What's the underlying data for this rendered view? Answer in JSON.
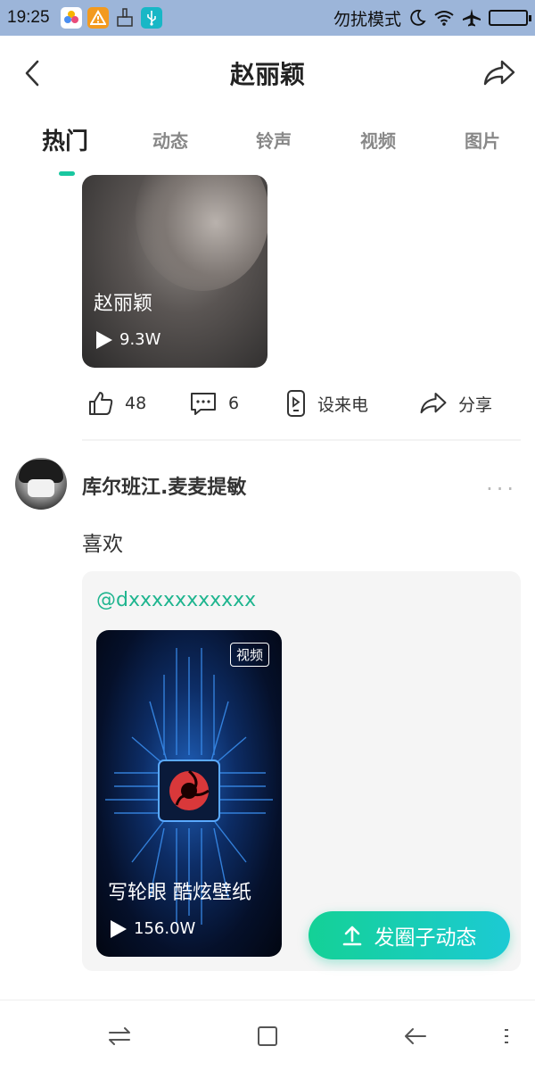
{
  "status_bar": {
    "time": "19:25",
    "mode_label": "勿扰模式"
  },
  "header": {
    "title": "赵丽颖"
  },
  "tabs": [
    {
      "label": "热门",
      "active": true
    },
    {
      "label": "动态",
      "active": false
    },
    {
      "label": "铃声",
      "active": false
    },
    {
      "label": "视频",
      "active": false
    },
    {
      "label": "图片",
      "active": false
    }
  ],
  "post1": {
    "card_title": "赵丽颖",
    "play_count": "9.3W",
    "actions": {
      "like_count": "48",
      "comment_count": "6",
      "set_ring_label": "设来电",
      "share_label": "分享"
    }
  },
  "post2": {
    "username": "库尔班江.麦麦提敏",
    "text": "喜欢",
    "mention": "@dxxxxxxxxxxx",
    "video": {
      "badge": "视频",
      "title": "写轮眼 酷炫壁纸",
      "play_count": "156.0W"
    }
  },
  "fab": {
    "label": "发圈子动态"
  },
  "colors": {
    "accent": "#19c7a0",
    "mention": "#1fb58f",
    "status_bar": "#9cb5d9"
  }
}
